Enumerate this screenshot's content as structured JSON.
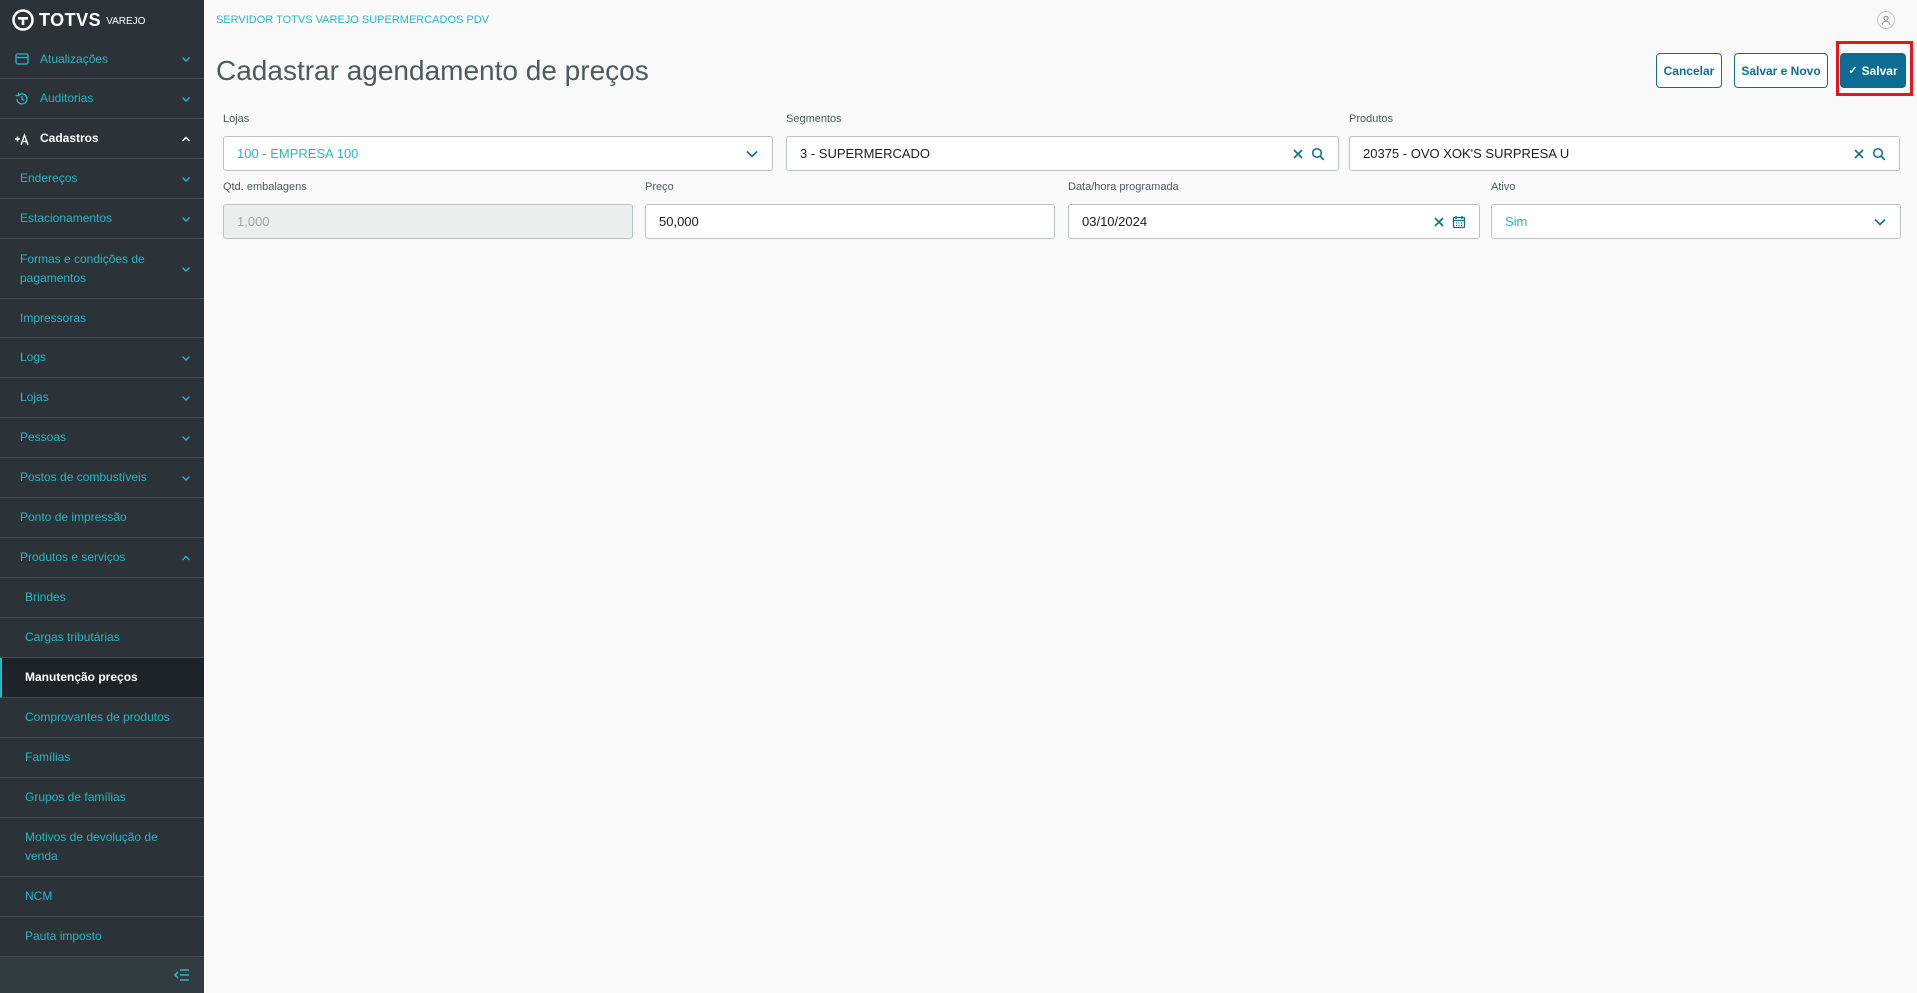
{
  "brand": {
    "name": "TOTVS",
    "sub": "VAREJO"
  },
  "sidebar": {
    "items": [
      {
        "label": "Atualizações",
        "icon": "update-icon",
        "level": 0
      },
      {
        "label": "Auditorias",
        "icon": "history-icon",
        "level": 0
      },
      {
        "label": "Cadastros",
        "icon": "add-user-icon",
        "level": 0,
        "open": true
      },
      {
        "label": "Endereços",
        "level": 1
      },
      {
        "label": "Estacionamentos",
        "level": 1
      },
      {
        "label": "Formas e condições de pagamentos",
        "level": 1
      },
      {
        "label": "Impressoras",
        "level": 1,
        "leaf": true
      },
      {
        "label": "Logs",
        "level": 1
      },
      {
        "label": "Lojas",
        "level": 1
      },
      {
        "label": "Pessoas",
        "level": 1
      },
      {
        "label": "Postos de combustíveis",
        "level": 1
      },
      {
        "label": "Ponto de impressão",
        "level": 1,
        "leaf": true
      },
      {
        "label": "Produtos e serviços",
        "level": 1,
        "open": true
      },
      {
        "label": "Brindes",
        "level": 2
      },
      {
        "label": "Cargas tributárias",
        "level": 2
      },
      {
        "label": "Manutenção preços",
        "level": 2,
        "active": true
      },
      {
        "label": "Comprovantes de produtos",
        "level": 2
      },
      {
        "label": "Famílias",
        "level": 2
      },
      {
        "label": "Grupos de famílias",
        "level": 2
      },
      {
        "label": "Motivos de devolução de venda",
        "level": 2
      },
      {
        "label": "NCM",
        "level": 2
      },
      {
        "label": "Pauta imposto",
        "level": 2
      }
    ]
  },
  "header": {
    "server": "SERVIDOR TOTVS VAREJO SUPERMERCADOS PDV"
  },
  "page": {
    "title": "Cadastrar agendamento de preços",
    "actions": {
      "cancel": "Cancelar",
      "save_new": "Salvar e Novo",
      "save": "Salvar"
    }
  },
  "form": {
    "lojas": {
      "label": "Lojas",
      "value": "100 - EMPRESA 100"
    },
    "segmentos": {
      "label": "Segmentos",
      "value": "3 - SUPERMERCADO"
    },
    "produtos": {
      "label": "Produtos",
      "value": "20375 - OVO XOK'S SURPRESA U"
    },
    "qtd": {
      "label": "Qtd. embalagens",
      "value": "1,000"
    },
    "preco": {
      "label": "Preço",
      "value": "50,000"
    },
    "data": {
      "label": "Data/hora programada",
      "value": "03/10/2024"
    },
    "ativo": {
      "label": "Ativo",
      "value": "Sim"
    }
  },
  "colors": {
    "accent": "#29b6c5",
    "primary": "#0c6c94",
    "sidebar": "#2b3338",
    "highlight": "#e3181f"
  }
}
